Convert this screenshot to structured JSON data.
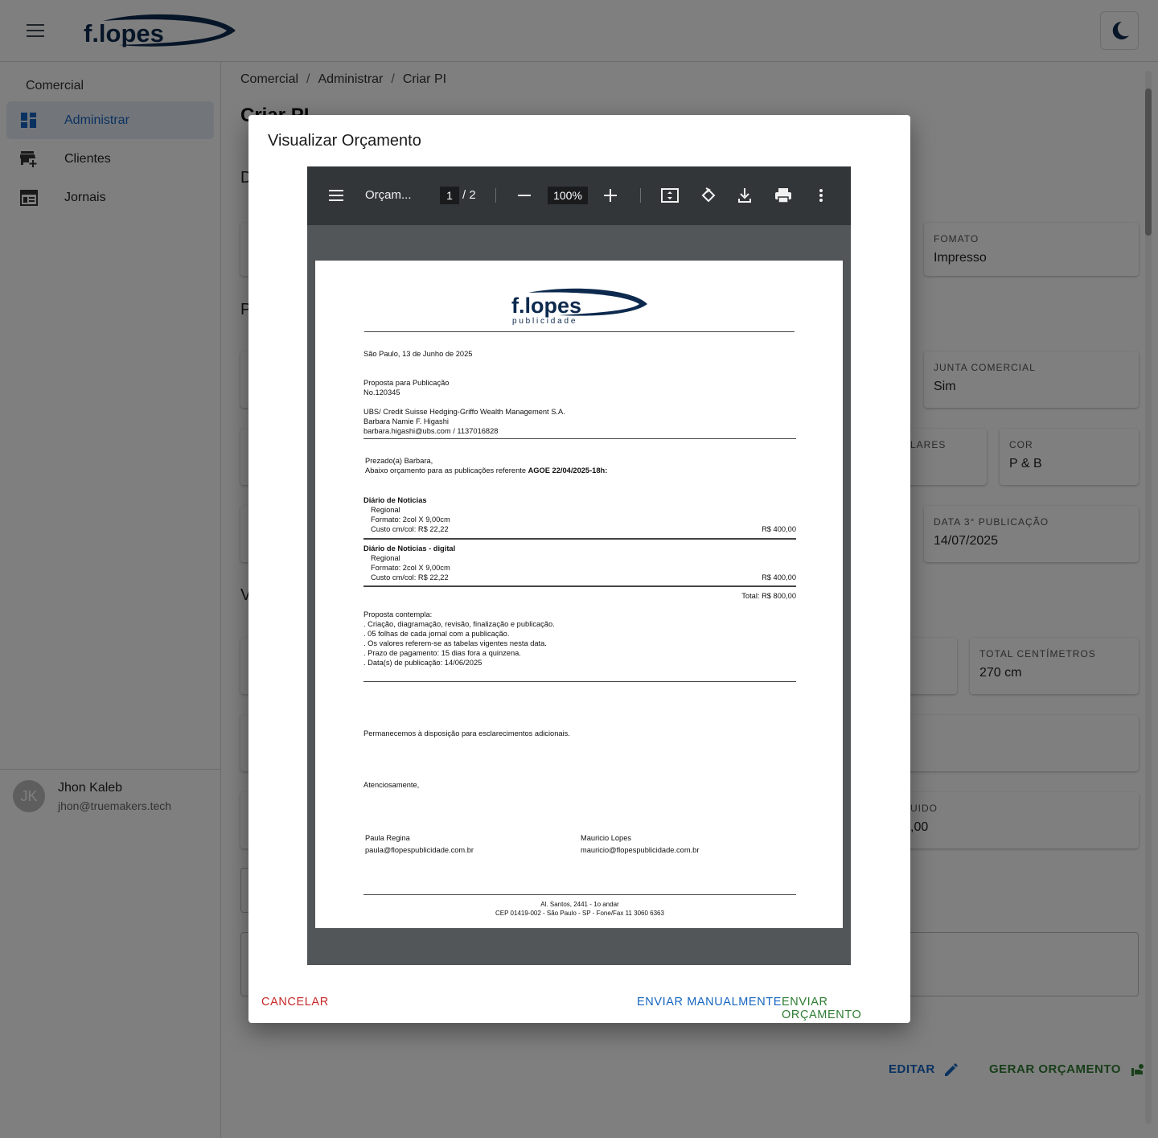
{
  "app": {
    "logo_text": "f.lopes",
    "theme_toggle_icon": "moon-icon"
  },
  "sidebar": {
    "section": "Comercial",
    "items": [
      {
        "label": "Administrar",
        "icon": "dashboard-icon",
        "active": true
      },
      {
        "label": "Clientes",
        "icon": "store-add-icon",
        "active": false
      },
      {
        "label": "Jornais",
        "icon": "newspaper-icon",
        "active": false
      }
    ],
    "user": {
      "initials": "JK",
      "name": "Jhon Kaleb",
      "email": "jhon@truemakers.tech"
    }
  },
  "breadcrumb": [
    "Comercial",
    "Administrar",
    "Criar PI"
  ],
  "page": {
    "title": "Criar PI",
    "section_letters": [
      "D",
      "P",
      "V"
    ]
  },
  "fields": [
    {
      "label": "FOMATO",
      "value": "Impresso"
    },
    {
      "label": "JUNTA COMERCIAL",
      "value": "Sim"
    },
    {
      "label": "LARES",
      "value": ""
    },
    {
      "label": "COR",
      "value": "P & B"
    },
    {
      "label": "DATA 3° PUBLICAÇÃO",
      "value": "14/07/2025"
    },
    {
      "label": "TOTAL CENTÍMETROS",
      "value": "270 cm"
    },
    {
      "label": "UIDO",
      "value": ",00"
    }
  ],
  "page_actions": {
    "edit": "EDITAR",
    "generate": "GERAR ORÇAMENTO"
  },
  "dialog": {
    "title": "Visualizar Orçamento",
    "cancel": "CANCELAR",
    "send_manual": "ENVIAR MANUALMENTE",
    "send": "ENVIAR ORÇAMENTO"
  },
  "pdf_viewer": {
    "doc_title": "Orçam...",
    "current_page": "1",
    "total_pages": "/ 2",
    "zoom": "100%"
  },
  "pdf": {
    "logo_main": "f.lopes",
    "logo_sub": "p u b l i c i d a d e",
    "date_line": "São Paulo, 13 de Junho de 2025",
    "proposal_title": "Proposta para Publicação",
    "proposal_number": "No.120345",
    "client_company": "UBS/ Credit Suisse Hedging-Griffo Wealth Management S.A.",
    "client_contact": "Barbara Namie F. Higashi",
    "client_email_phone": "barbara.higashi@ubs.com / 1137016828",
    "greeting": "Prezado(a) Barbara,",
    "intro_prefix": "Abaixo orçamento para as publicações referente ",
    "intro_bold": "AGOE 22/04/2025-18h:",
    "items": [
      {
        "name": "Diário de Noticias",
        "region": "Regional",
        "format": "Formato: 2col X 9,00cm",
        "cost": "Custo cm/col: R$ 22,22",
        "price": "R$ 400,00"
      },
      {
        "name": "Diário de Noticias - digital",
        "region": "Regional",
        "format": "Formato: 2col X 9,00cm",
        "cost": "Custo cm/col: R$ 22,22",
        "price": "R$ 400,00"
      }
    ],
    "total": "Total: R$ 800,00",
    "terms": [
      "Proposta contempla:",
      ". Criação, diagramação, revisão, finalização e publicação.",
      ". 05 folhas de cada jornal com a publicação.",
      ". Os valores referem-se as tabelas vigentes nesta data.",
      ". Prazo de pagamento: 15 dias fora a quinzena.",
      ". Data(s) de publicação: 14/06/2025"
    ],
    "closing": "Permanecemos à disposição para esclarecimentos adicionais.",
    "regards": "Atenciosamente,",
    "signers": [
      {
        "name": "Paula Regina",
        "email": "paula@flopespublicidade.com.br"
      },
      {
        "name": "Mauricio Lopes",
        "email": "mauricio@flopespublicidade.com.br"
      }
    ],
    "footer_address": "Al. Santos, 2441 - 1o andar",
    "footer_contact": "CEP 01419-002 - São Paulo - SP - Fone/Fax 11 3060 6363"
  },
  "colors": {
    "primary": "#1565c0",
    "success": "#2e7d32",
    "danger": "#c62828",
    "brand_navy": "#0d2a4e"
  }
}
